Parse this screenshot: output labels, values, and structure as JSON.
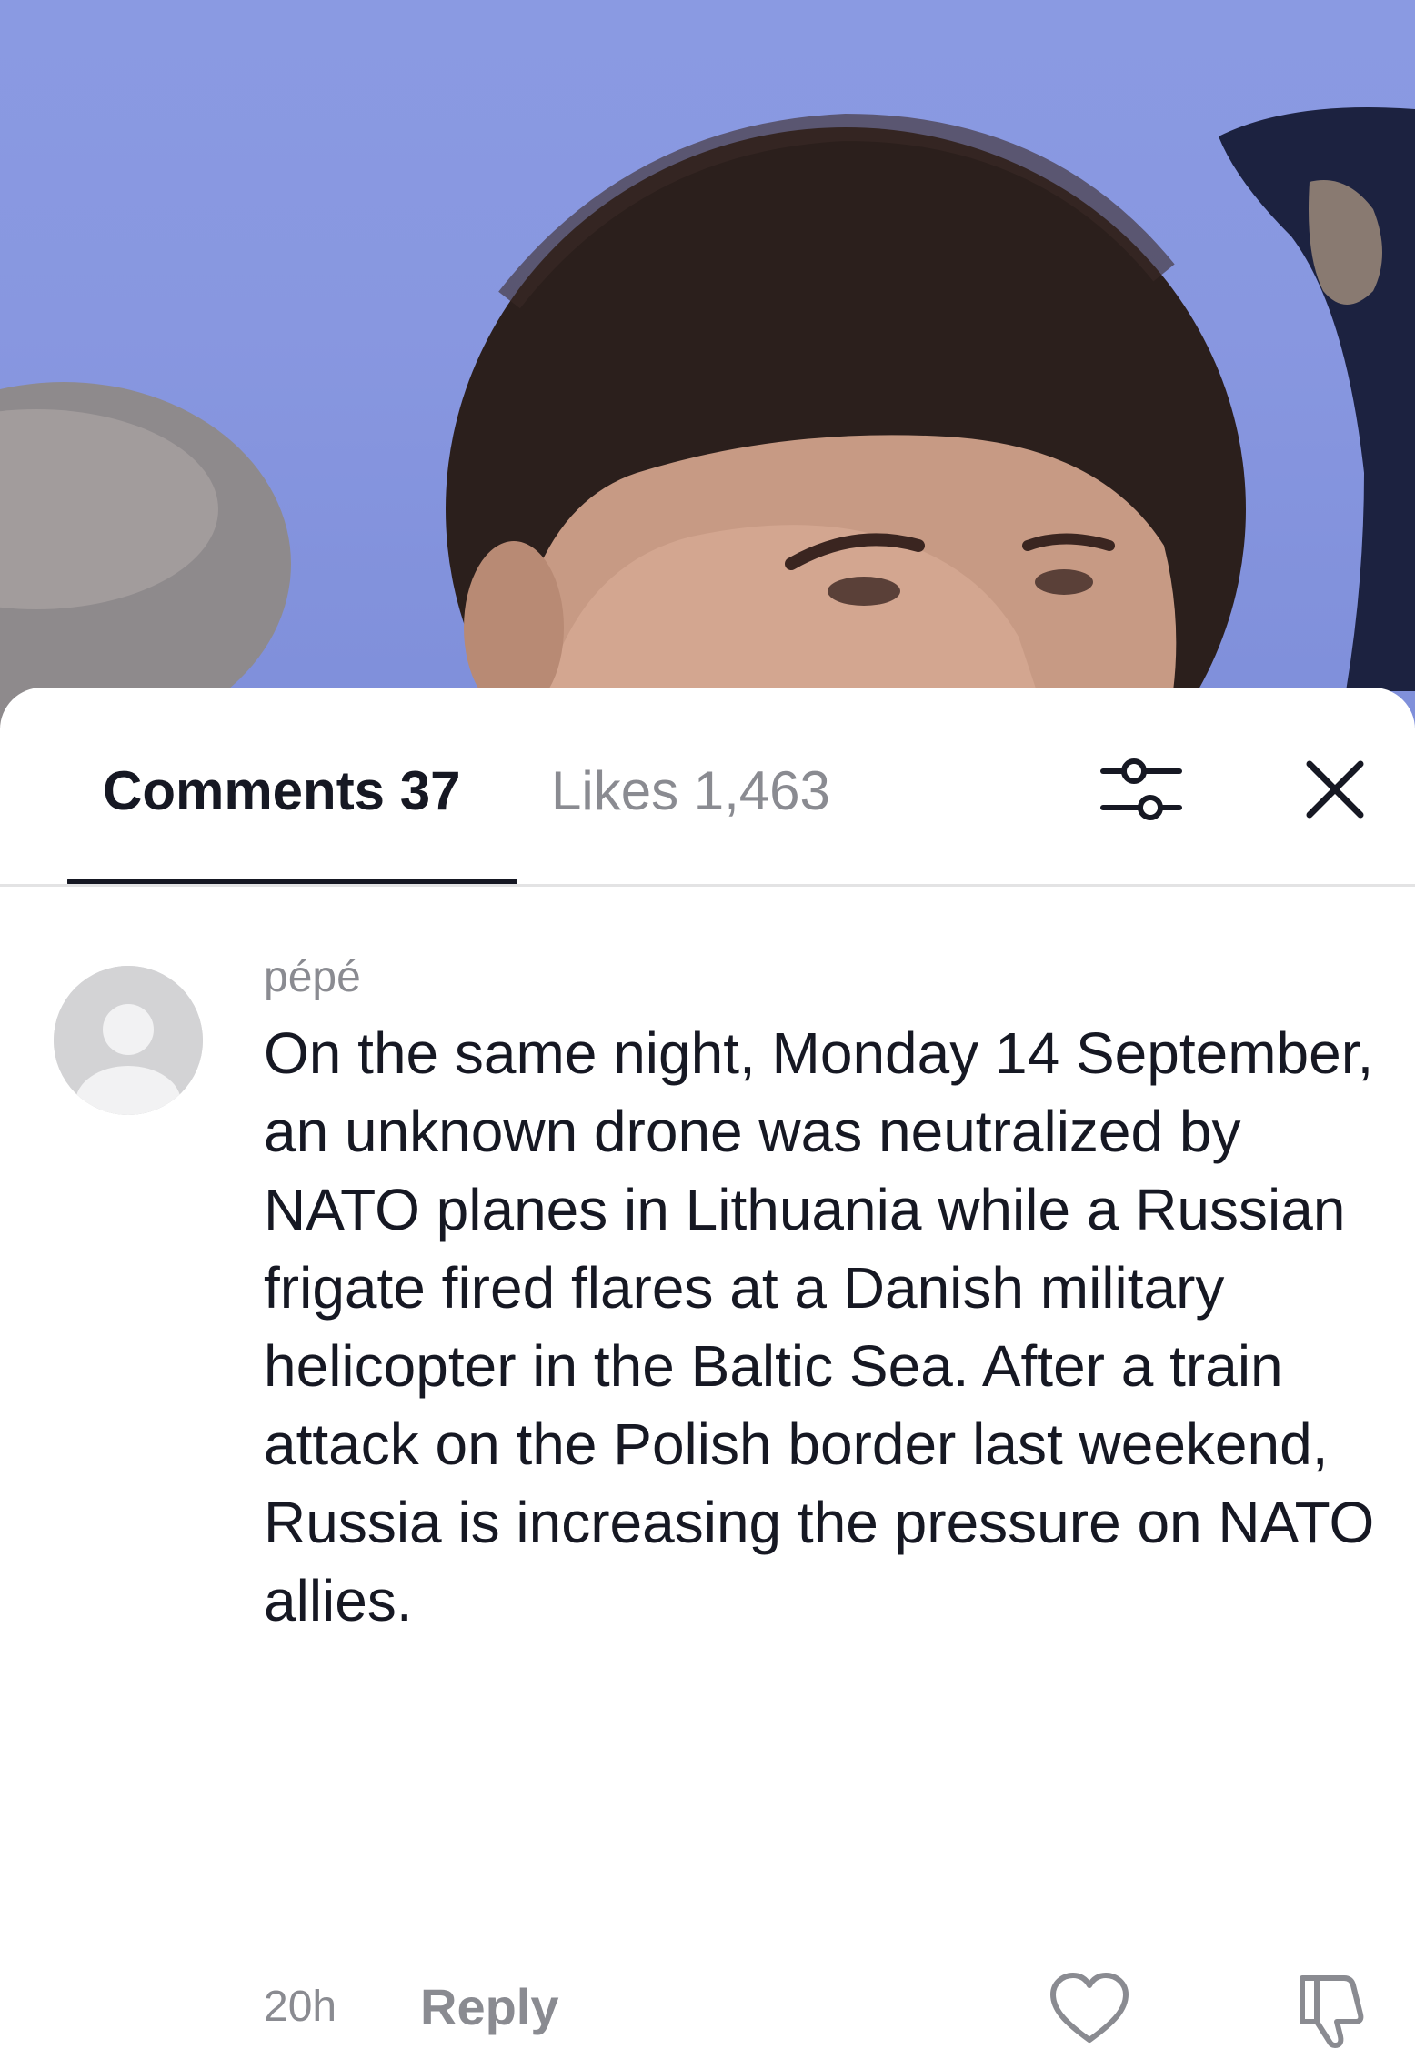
{
  "video": {
    "background_color": "#8a9ae2"
  },
  "comments_sheet": {
    "tabs": [
      {
        "label": "Comments",
        "count": "37",
        "active": true
      },
      {
        "label": "Likes",
        "count": "1,463",
        "active": false
      }
    ],
    "icons": {
      "filter": "sliders-icon",
      "close": "close-icon"
    },
    "accent_color": "#161823",
    "muted_color": "#8a8b91"
  },
  "comment": {
    "username": "pépé",
    "text": "On the same night, Monday 14 September, an unknown drone was neutralized by NATO planes in Lithuania while a Russian frigate fired flares at a Danish military helicopter in the Baltic Sea. After a train attack on the Polish border last weekend, Russia is increasing the pressure on NATO allies.",
    "timestamp": "20h",
    "reply_label": "Reply",
    "icons": {
      "avatar": "default-avatar-icon",
      "like": "heart-icon",
      "dislike": "thumbs-down-icon"
    }
  }
}
